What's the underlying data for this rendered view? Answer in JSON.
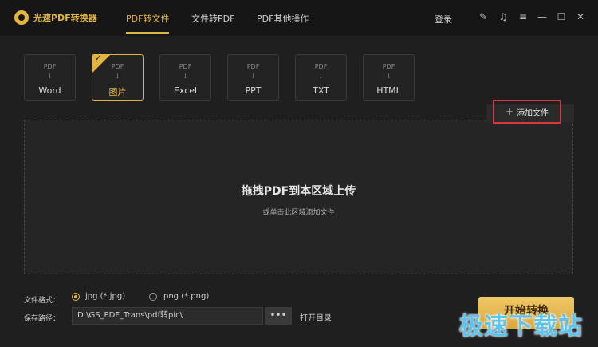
{
  "header": {
    "app_title": "光速PDF转换器",
    "tabs": [
      {
        "label": "PDF转文件"
      },
      {
        "label": "文件转PDF"
      },
      {
        "label": "PDF其他操作"
      }
    ],
    "login_label": "登录",
    "accent_color": "#e4b443"
  },
  "formats": {
    "source_label": "PDF",
    "arrow": "↓",
    "items": [
      {
        "label": "Word"
      },
      {
        "label": "图片"
      },
      {
        "label": "Excel"
      },
      {
        "label": "PPT"
      },
      {
        "label": "TXT"
      },
      {
        "label": "HTML"
      }
    ],
    "selected": "图片"
  },
  "add_file": {
    "icon": "+",
    "label": "添加文件"
  },
  "drop_zone": {
    "title": "拖拽PDF到本区域上传",
    "subtitle": "或单击此区域添加文件"
  },
  "options": {
    "format_label": "文件格式：",
    "formats": [
      {
        "label": "jpg (*.jpg)",
        "checked": true
      },
      {
        "label": "png (*.png)",
        "checked": false
      }
    ],
    "path_label": "保存路径：",
    "path_value": "D:\\GS_PDF_Trans\\pdf转pic\\",
    "browse_label": "•••",
    "open_dir_label": "打开目录"
  },
  "start_button": {
    "label": "开始转换"
  },
  "watermark": "极速下载站"
}
